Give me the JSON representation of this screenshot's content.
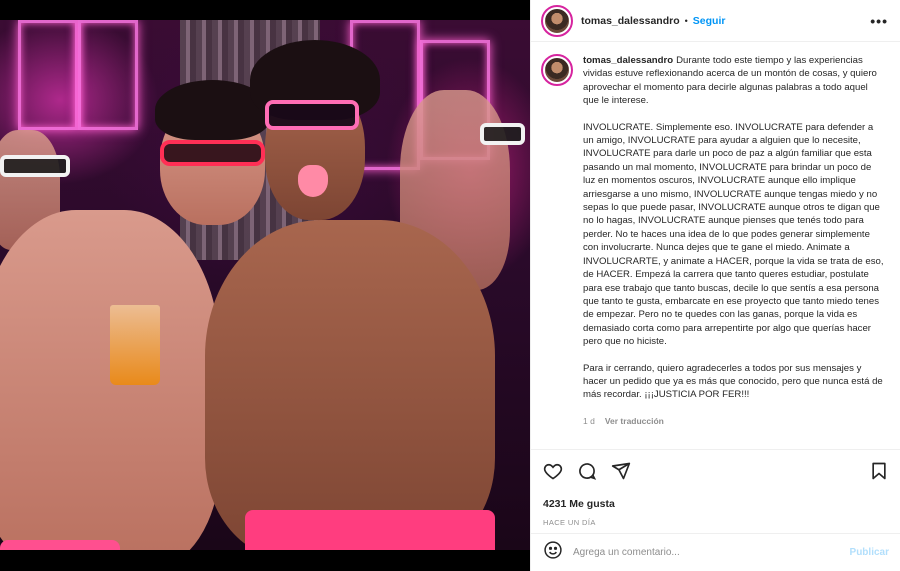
{
  "post": {
    "username": "tomas_dalessandro",
    "follow_label": "Seguir",
    "more_label": "•••",
    "caption_paragraphs": [
      "Durante todo este tiempo y las experiencias vividas estuve reflexionando acerca de un montón de cosas, y quiero aprovechar el momento para decirle algunas palabras a todo aquel que le interese.",
      "INVOLUCRATE. Simplemente eso. INVOLUCRATE para defender a un amigo, INVOLUCRATE para ayudar a alguien que lo necesite, INVOLUCRATE para darle un poco de paz a algún familiar que esta pasando un mal momento, INVOLUCRATE para brindar un poco de luz en momentos oscuros, INVOLUCRATE aunque ello implique arriesgarse a uno mismo, INVOLUCRATE aunque tengas miedo y no sepas lo que puede pasar, INVOLUCRATE aunque otros te digan que no lo hagas, INVOLUCRATE aunque pienses que tenés todo para perder. No te haces una idea de lo que podes generar simplemente con involucrarte. Nunca dejes que te gane el miedo. Animate a INVOLUCRARTE, y animate a HACER, porque la vida se trata de eso, de HACER. Empezá la carrera que tanto queres estudiar, postulate para ese trabajo que tanto buscas, decile lo que sentís a esa persona que tanto te gusta, embarcate en ese proyecto que tanto miedo tenes de empezar. Pero no te quedes con las ganas, porque la vida es demasiado corta como para arrepentirte por algo que querías hacer pero que no hiciste.",
      "Para ir cerrando, quiero agradecerles a todos por sus mensajes y hacer un pedido que ya es más que conocido, pero que nunca está de más recordar. ¡¡¡JUSTICIA POR FER!!!"
    ],
    "time_short": "1 d",
    "translate_label": "Ver traducción",
    "likes": "4231 Me gusta",
    "posted_ago": "HACE UN DÍA",
    "comment_placeholder": "Agrega un comentario...",
    "publish_label": "Publicar"
  },
  "icons": [
    "heart-icon",
    "comment-icon",
    "share-icon",
    "bookmark-icon",
    "emoji-icon"
  ],
  "colors": {
    "link_blue": "#0095f6",
    "publish_disabled": "#b2dffc",
    "neon_pink": "#ff5fd0"
  }
}
